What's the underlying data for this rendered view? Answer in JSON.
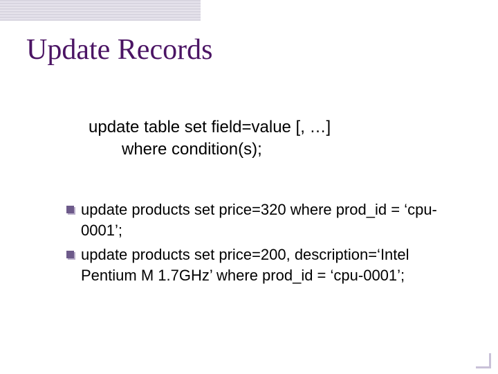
{
  "title": "Update Records",
  "syntax": {
    "line1": "update table set field=value [, …]",
    "line2": "where condition(s);"
  },
  "bullets": [
    "update products set price=320 where prod_id = ‘cpu-0001’;",
    "update products set price=200, description=‘Intel Pentium M 1.7GHz’ where prod_id = ‘cpu-0001’;"
  ]
}
